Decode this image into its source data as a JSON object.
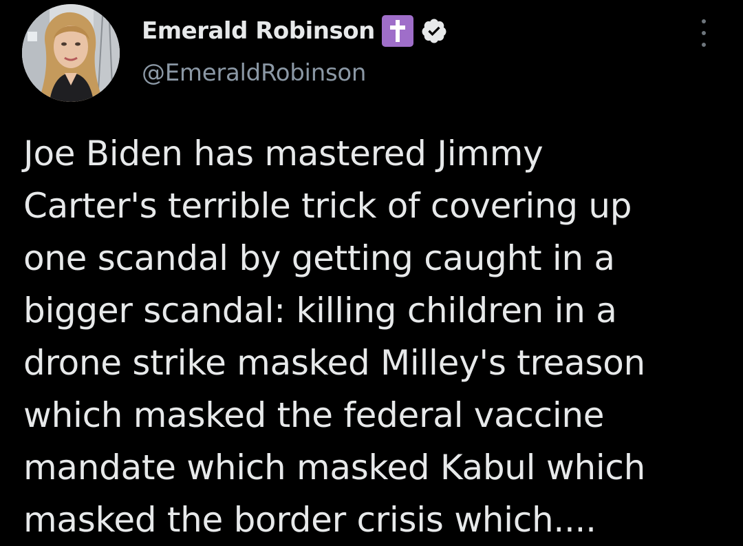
{
  "user": {
    "display_name": "Emerald Robinson",
    "emoji_badge": "latin-cross-icon",
    "verified_badge": "verified-checkmark-icon",
    "handle": "@EmeraldRobinson"
  },
  "tweet": {
    "lines": [
      "Joe Biden has mastered Jimmy",
      "Carter's terrible trick of covering up",
      "one scandal by getting caught in a",
      "bigger scandal: killing children in a",
      "drone strike masked Milley's treason",
      "which masked the federal vaccine",
      "mandate which masked Kabul which",
      "masked the border crisis which...."
    ]
  },
  "menu": {
    "icon": "more-options-icon"
  },
  "colors": {
    "background": "#000000",
    "primary_text": "#e7e9ea",
    "secondary_text": "#8b98a5",
    "badge_purple": "#9f6ec9"
  }
}
